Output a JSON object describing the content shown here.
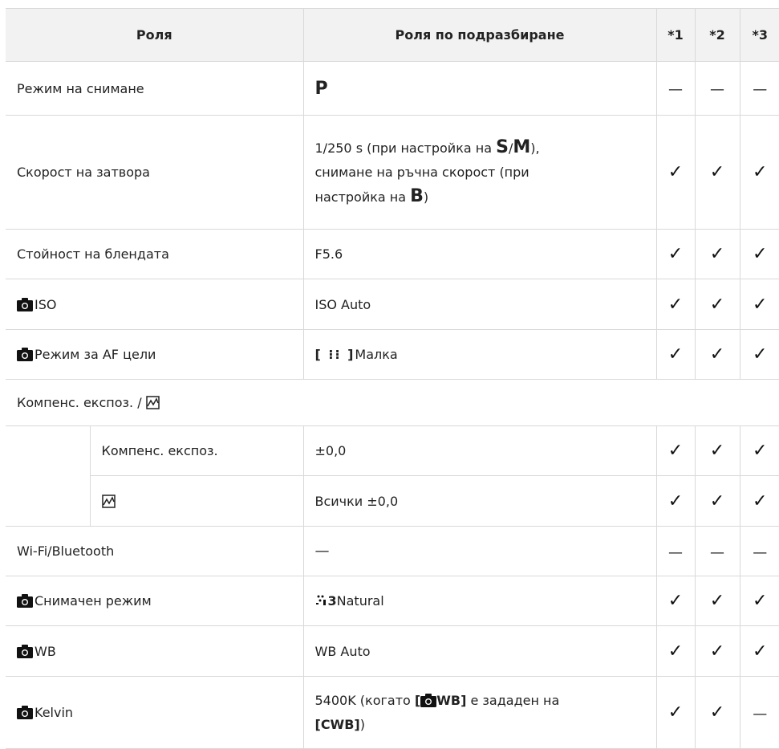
{
  "header": {
    "col1": "Роля",
    "col2": "Роля по подразбиране",
    "m1": "*1",
    "m2": "*2",
    "m3": "*3"
  },
  "rows": {
    "r1": {
      "label": "Режим на снимане",
      "value": "P"
    },
    "r2": {
      "label": "Скорост на затвора",
      "v_a": "1/250 s (при настройка на ",
      "v_s": "S",
      "v_slash": "/",
      "v_m": "M",
      "v_b": "),",
      "v_c": "снимане на ръчна скорост (при",
      "v_d": "настройка на ",
      "v_bb": "B",
      "v_e": ")"
    },
    "r3": {
      "label": "Стойност на блендата",
      "value": "F5.6"
    },
    "r4": {
      "label": "ISO",
      "value": "ISO Auto",
      "icon": "camera-icon"
    },
    "r5": {
      "label": "Режим за AF цели",
      "value_icon": "[ ⁝⁝ ]",
      "value": "Малка",
      "icon": "camera-icon"
    },
    "group": {
      "label": "Компенс. експоз. / ",
      "icon": "highlight-shadow-icon"
    },
    "r6": {
      "label": "Компенс. експоз.",
      "value": "±0,0"
    },
    "r7": {
      "label_icon": "highlight-shadow-icon",
      "value": "Всички ±0,0"
    },
    "r8": {
      "label": "Wi-Fi/Bluetooth",
      "value": "—"
    },
    "r9": {
      "label": "Снимачен режим",
      "value_icon": "3",
      "value": "Natural",
      "icon": "camera-icon"
    },
    "r10": {
      "label": "WB",
      "value": "WB Auto",
      "icon": "camera-icon"
    },
    "r11": {
      "label": "Kelvin",
      "icon": "camera-icon",
      "v_a": "5400K (когато ",
      "v_b1": "[",
      "v_b2": "WB]",
      "v_c": " е зададен на",
      "v_d": "[CWB]",
      "v_e": ")"
    }
  },
  "marks": {
    "check": "✓",
    "dash": "—"
  }
}
